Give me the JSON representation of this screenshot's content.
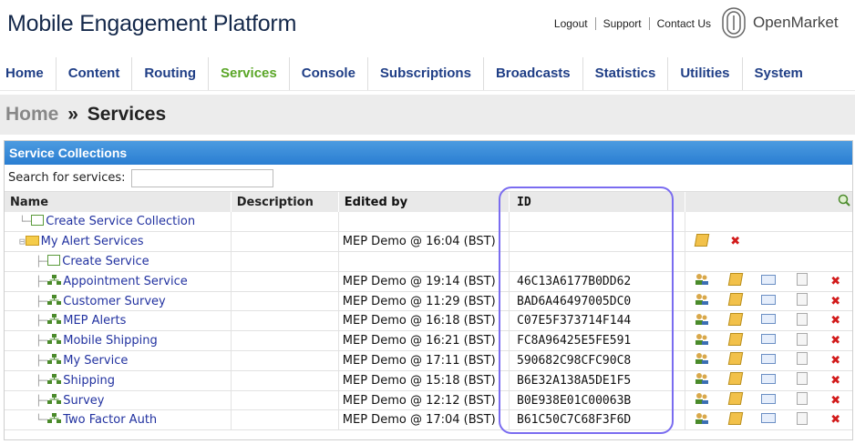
{
  "header": {
    "app_title": "Mobile Engagement Platform",
    "links": [
      "Logout",
      "Support",
      "Contact Us"
    ],
    "brand": "OpenMarket"
  },
  "nav": {
    "items": [
      "Home",
      "Content",
      "Routing",
      "Services",
      "Console",
      "Subscriptions",
      "Broadcasts",
      "Statistics",
      "Utilities",
      "System"
    ],
    "active": "Services"
  },
  "breadcrumb": {
    "home": "Home",
    "separator": "»",
    "current": "Services"
  },
  "panel": {
    "title": "Service Collections",
    "search_label": "Search for services:",
    "search_value": "",
    "columns": {
      "name": "Name",
      "description": "Description",
      "edited_by": "Edited by",
      "id": "ID"
    }
  },
  "rows": [
    {
      "name": "Create Service Collection",
      "description": "",
      "edited_by": "",
      "id": ""
    },
    {
      "name": "My Alert Services",
      "description": "",
      "edited_by": "MEP Demo @ 16:04 (BST)",
      "id": ""
    },
    {
      "name": "Create Service",
      "description": "",
      "edited_by": "",
      "id": ""
    },
    {
      "name": "Appointment Service",
      "description": "",
      "edited_by": "MEP Demo @ 19:14 (BST)",
      "id": "46C13A6177B0DD62"
    },
    {
      "name": "Customer Survey",
      "description": "",
      "edited_by": "MEP Demo @ 11:29 (BST)",
      "id": "BAD6A46497005DC0"
    },
    {
      "name": "MEP Alerts",
      "description": "",
      "edited_by": "MEP Demo @ 16:18 (BST)",
      "id": "C07E5F373714F144"
    },
    {
      "name": "Mobile Shipping",
      "description": "",
      "edited_by": "MEP Demo @ 16:21 (BST)",
      "id": "FC8A96425E5FE591"
    },
    {
      "name": "My Service",
      "description": "",
      "edited_by": "MEP Demo @ 17:11 (BST)",
      "id": "590682C98CFC90C8"
    },
    {
      "name": "Shipping",
      "description": "",
      "edited_by": "MEP Demo @ 15:18 (BST)",
      "id": "B6E32A138A5DE1F5"
    },
    {
      "name": "Survey",
      "description": "",
      "edited_by": "MEP Demo @ 12:12 (BST)",
      "id": "B0E938E01C00063B"
    },
    {
      "name": "Two Factor Auth",
      "description": "",
      "edited_by": "MEP Demo @ 17:04 (BST)",
      "id": "B61C50C7C68F3F6D"
    }
  ],
  "colors": {
    "accent": "#2a7ed2",
    "nav": "#1f3e86",
    "nav_active": "#5aa627",
    "highlight": "#7a6cf0"
  }
}
